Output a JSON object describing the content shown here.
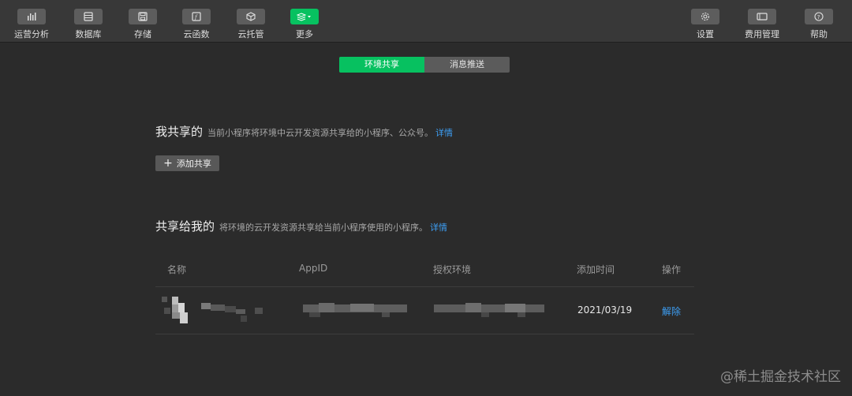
{
  "toolbar": {
    "items": [
      {
        "label": "运营分析",
        "icon": "bar-chart-icon"
      },
      {
        "label": "数据库",
        "icon": "database-icon"
      },
      {
        "label": "存储",
        "icon": "save-icon"
      },
      {
        "label": "云函数",
        "icon": "function-icon"
      },
      {
        "label": "云托管",
        "icon": "cube-icon"
      },
      {
        "label": "更多",
        "icon": "layers-icon"
      }
    ],
    "right_items": [
      {
        "label": "设置",
        "icon": "gear-icon"
      },
      {
        "label": "费用管理",
        "icon": "billing-icon"
      },
      {
        "label": "帮助",
        "icon": "help-icon"
      }
    ],
    "active_color": "#07c160"
  },
  "tabs": [
    {
      "label": "环境共享",
      "active": true
    },
    {
      "label": "消息推送",
      "active": false
    }
  ],
  "my_share": {
    "title": "我共享的",
    "desc": "当前小程序将环境中云开发资源共享给的小程序、公众号。",
    "link": "详情",
    "add_button": "添加共享"
  },
  "shared_to_me": {
    "title": "共享给我的",
    "desc": "将环境的云开发资源共享给当前小程序使用的小程序。",
    "link": "详情",
    "columns": [
      "名称",
      "AppID",
      "授权环境",
      "添加时间",
      "操作"
    ],
    "rows": [
      {
        "added": "2021/03/19",
        "action": "解除"
      }
    ]
  },
  "watermark": "@稀土掘金技术社区",
  "link_color": "#3d9ff5"
}
